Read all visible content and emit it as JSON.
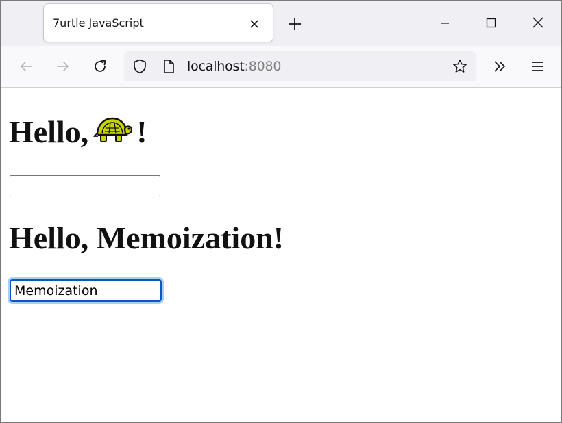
{
  "window": {
    "tab": {
      "title": "7urtle JavaScript"
    },
    "controls": [
      "minimize-icon",
      "maximize-icon",
      "close-icon"
    ]
  },
  "navbar": {
    "url_host": "localhost",
    "url_port": ":8080"
  },
  "page": {
    "heading1": {
      "prefix": "Hello,",
      "suffix": "!",
      "emoji": "turtle"
    },
    "input1": {
      "value": ""
    },
    "heading2": {
      "text": "Hello, Memoization!"
    },
    "input2": {
      "value": "Memoization"
    }
  },
  "colors": {
    "focus_border": "#0a57c8",
    "focus_ring": "#aad1f5",
    "tabstrip": "#f0f0f4"
  }
}
